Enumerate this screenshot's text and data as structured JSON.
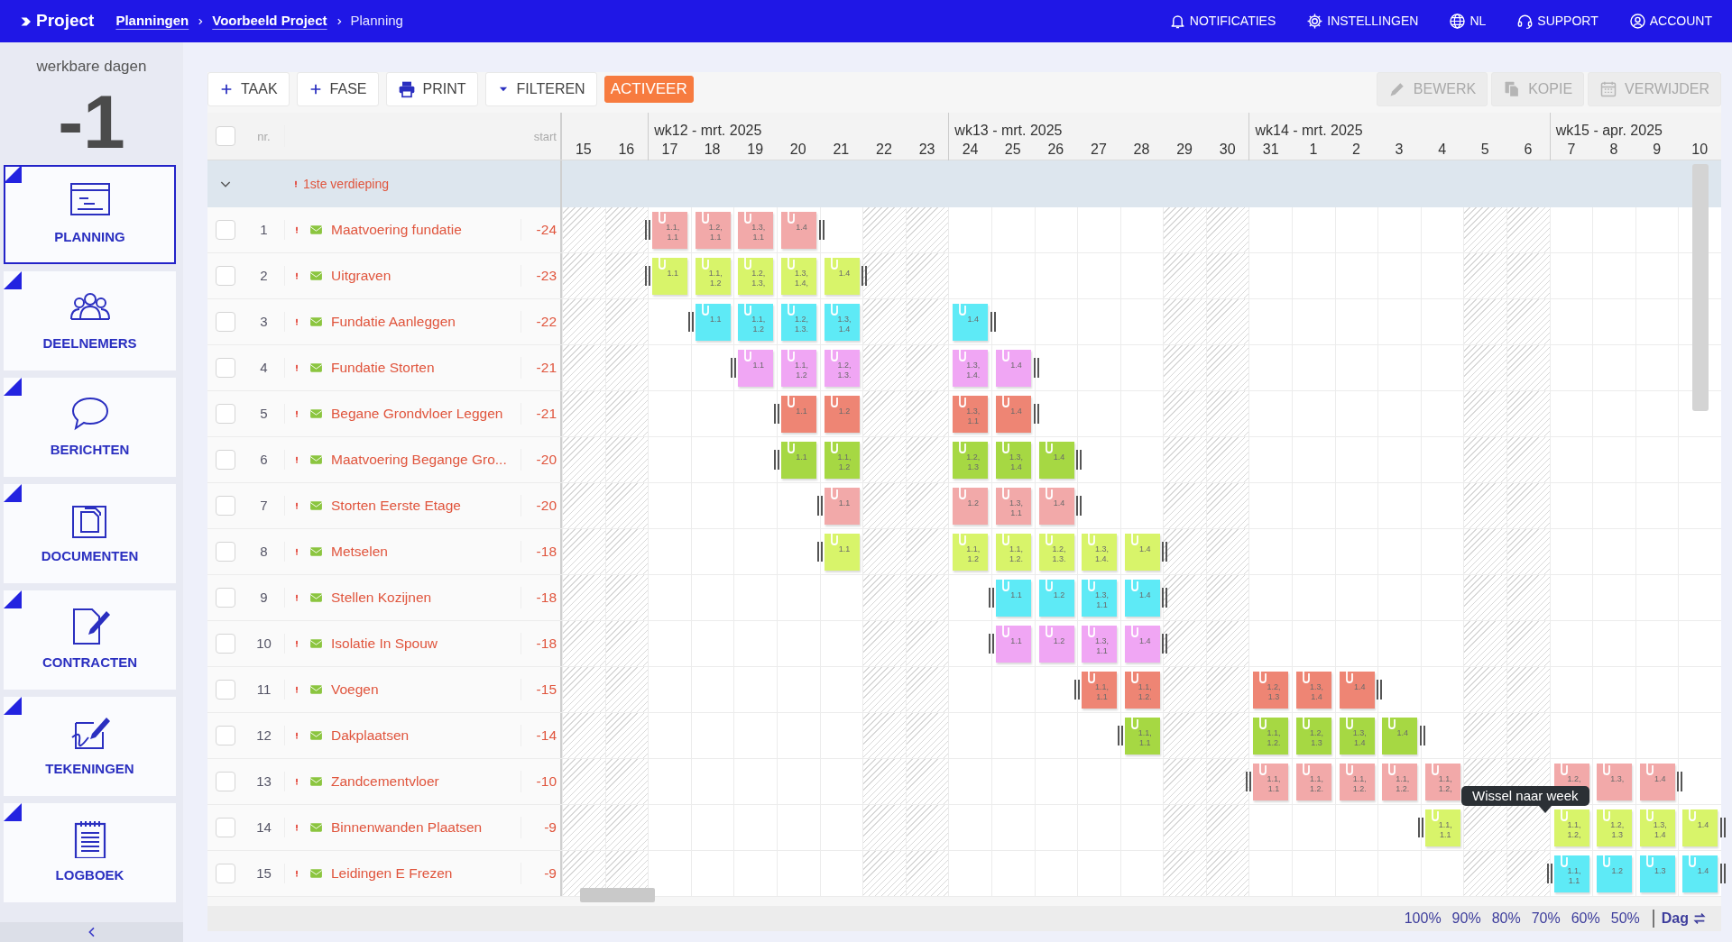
{
  "topbar": {
    "logo": "Project",
    "breadcrumbs": [
      {
        "label": "Planningen",
        "link": true
      },
      {
        "label": "Voorbeeld Project",
        "link": true
      },
      {
        "label": "Planning",
        "link": false
      }
    ],
    "menu": [
      {
        "label": "NOTIFICATIES"
      },
      {
        "label": "INSTELLINGEN"
      },
      {
        "label": "NL"
      },
      {
        "label": "SUPPORT"
      },
      {
        "label": "ACCOUNT"
      }
    ]
  },
  "sidebar": {
    "counter_label": "werkbare dagen",
    "counter": "-1",
    "items": [
      {
        "label": "PLANNING",
        "selected": true
      },
      {
        "label": "DEELNEMERS",
        "selected": false
      },
      {
        "label": "BERICHTEN",
        "selected": false
      },
      {
        "label": "DOCUMENTEN",
        "selected": false
      },
      {
        "label": "CONTRACTEN",
        "selected": false
      },
      {
        "label": "TEKENINGEN",
        "selected": false
      },
      {
        "label": "LOGBOEK",
        "selected": false
      }
    ]
  },
  "toolbar": {
    "left": [
      {
        "label": "TAAK",
        "kind": "add"
      },
      {
        "label": "FASE",
        "kind": "add"
      },
      {
        "label": "PRINT",
        "kind": "print"
      },
      {
        "label": "FILTEREN",
        "kind": "filter"
      },
      {
        "label": "ACTIVEER",
        "kind": "accent"
      }
    ],
    "right": [
      {
        "label": "BEWERK",
        "disabled": true
      },
      {
        "label": "KOPIE",
        "disabled": true
      },
      {
        "label": "VERWIJDER",
        "disabled": true
      }
    ]
  },
  "gantt": {
    "header": {
      "checked": false,
      "nr": "nr.",
      "start": "start"
    },
    "days": [
      {
        "label": "15",
        "weekend": true
      },
      {
        "label": "16",
        "weekend": true
      },
      {
        "label": "17",
        "weekend": false,
        "week": "wk12 - mrt. 2025"
      },
      {
        "label": "18",
        "weekend": false
      },
      {
        "label": "19",
        "weekend": false
      },
      {
        "label": "20",
        "weekend": false
      },
      {
        "label": "21",
        "weekend": false
      },
      {
        "label": "22",
        "weekend": true
      },
      {
        "label": "23",
        "weekend": true
      },
      {
        "label": "24",
        "weekend": false,
        "week": "wk13 - mrt. 2025"
      },
      {
        "label": "25",
        "weekend": false
      },
      {
        "label": "26",
        "weekend": false
      },
      {
        "label": "27",
        "weekend": false
      },
      {
        "label": "28",
        "weekend": false
      },
      {
        "label": "29",
        "weekend": true
      },
      {
        "label": "30",
        "weekend": true
      },
      {
        "label": "31",
        "weekend": false,
        "week": "wk14 - mrt. 2025"
      },
      {
        "label": "1",
        "weekend": false
      },
      {
        "label": "2",
        "weekend": false
      },
      {
        "label": "3",
        "weekend": false
      },
      {
        "label": "4",
        "weekend": false
      },
      {
        "label": "5",
        "weekend": true
      },
      {
        "label": "6",
        "weekend": true
      },
      {
        "label": "7",
        "weekend": false,
        "week": "wk15 - apr. 2025"
      },
      {
        "label": "8",
        "weekend": false
      },
      {
        "label": "9",
        "weekend": false
      },
      {
        "label": "10",
        "weekend": false
      }
    ],
    "group": {
      "label": "1ste verdieping",
      "expanded": true,
      "priority": true
    },
    "rows": [
      {
        "nr": "1",
        "name": "Maatvoering fundatie",
        "start": "-24",
        "checked": false,
        "priority": true,
        "mail": true,
        "color": "#f2a9a9",
        "cells": [
          {
            "kind": "empty"
          },
          {
            "kind": "empty"
          },
          {
            "kind": "note",
            "label": "1.1, 1.1"
          },
          {
            "kind": "note",
            "label": "1.2, 1.1"
          },
          {
            "kind": "note",
            "label": "1.3, 1.1"
          },
          {
            "kind": "note",
            "label": "1.4"
          },
          {
            "kind": "empty"
          },
          {
            "kind": "empty"
          },
          {
            "kind": "empty"
          },
          {
            "kind": "empty"
          },
          {
            "kind": "empty"
          },
          {
            "kind": "empty"
          },
          {
            "kind": "empty"
          },
          {
            "kind": "empty"
          },
          {
            "kind": "empty"
          },
          {
            "kind": "empty"
          },
          {
            "kind": "empty"
          },
          {
            "kind": "empty"
          },
          {
            "kind": "empty"
          },
          {
            "kind": "empty"
          },
          {
            "kind": "empty"
          },
          {
            "kind": "empty"
          },
          {
            "kind": "empty"
          },
          {
            "kind": "empty"
          },
          {
            "kind": "empty"
          },
          {
            "kind": "empty"
          },
          {
            "kind": "empty"
          }
        ]
      },
      {
        "nr": "2",
        "name": "Uitgraven",
        "start": "-23",
        "checked": false,
        "priority": true,
        "mail": true,
        "color": "#d8f46a",
        "cells": [
          {
            "kind": "empty"
          },
          {
            "kind": "empty"
          },
          {
            "kind": "note",
            "label": "1.1"
          },
          {
            "kind": "note",
            "label": "1.1, 1.2"
          },
          {
            "kind": "note",
            "label": "1.2, 1.3,"
          },
          {
            "kind": "note",
            "label": "1.3, 1.4,"
          },
          {
            "kind": "note",
            "label": "1.4"
          },
          {
            "kind": "empty"
          },
          {
            "kind": "empty"
          },
          {
            "kind": "empty"
          },
          {
            "kind": "empty"
          },
          {
            "kind": "empty"
          },
          {
            "kind": "empty"
          },
          {
            "kind": "empty"
          },
          {
            "kind": "empty"
          },
          {
            "kind": "empty"
          },
          {
            "kind": "empty"
          },
          {
            "kind": "empty"
          },
          {
            "kind": "empty"
          },
          {
            "kind": "empty"
          },
          {
            "kind": "empty"
          },
          {
            "kind": "empty"
          },
          {
            "kind": "empty"
          },
          {
            "kind": "empty"
          },
          {
            "kind": "empty"
          },
          {
            "kind": "empty"
          },
          {
            "kind": "empty"
          }
        ]
      },
      {
        "nr": "3",
        "name": "Fundatie Aanleggen",
        "start": "-22",
        "checked": false,
        "priority": true,
        "mail": true,
        "color": "#5eeaf6",
        "cells": [
          {
            "kind": "empty"
          },
          {
            "kind": "empty"
          },
          {
            "kind": "empty"
          },
          {
            "kind": "note",
            "label": "1.1"
          },
          {
            "kind": "note",
            "label": "1.1, 1.2"
          },
          {
            "kind": "note",
            "label": "1.2, 1.3."
          },
          {
            "kind": "note",
            "label": "1.3, 1.4"
          },
          {
            "kind": "empty"
          },
          {
            "kind": "empty"
          },
          {
            "kind": "note",
            "label": "1.4"
          },
          {
            "kind": "empty"
          },
          {
            "kind": "empty"
          },
          {
            "kind": "empty"
          },
          {
            "kind": "empty"
          },
          {
            "kind": "empty"
          },
          {
            "kind": "empty"
          },
          {
            "kind": "empty"
          },
          {
            "kind": "empty"
          },
          {
            "kind": "empty"
          },
          {
            "kind": "empty"
          },
          {
            "kind": "empty"
          },
          {
            "kind": "empty"
          },
          {
            "kind": "empty"
          },
          {
            "kind": "empty"
          },
          {
            "kind": "empty"
          },
          {
            "kind": "empty"
          },
          {
            "kind": "empty"
          }
        ]
      },
      {
        "nr": "4",
        "name": "Fundatie Storten",
        "start": "-21",
        "checked": false,
        "priority": true,
        "mail": true,
        "color": "#f0a6f4",
        "cells": [
          {
            "kind": "empty"
          },
          {
            "kind": "empty"
          },
          {
            "kind": "empty"
          },
          {
            "kind": "empty"
          },
          {
            "kind": "note",
            "label": "1.1"
          },
          {
            "kind": "note",
            "label": "1.1, 1.2"
          },
          {
            "kind": "note",
            "label": "1.2, 1.3."
          },
          {
            "kind": "empty"
          },
          {
            "kind": "empty"
          },
          {
            "kind": "note",
            "label": "1.3, 1.4."
          },
          {
            "kind": "note",
            "label": "1.4"
          },
          {
            "kind": "empty"
          },
          {
            "kind": "empty"
          },
          {
            "kind": "empty"
          },
          {
            "kind": "empty"
          },
          {
            "kind": "empty"
          },
          {
            "kind": "empty"
          },
          {
            "kind": "empty"
          },
          {
            "kind": "empty"
          },
          {
            "kind": "empty"
          },
          {
            "kind": "empty"
          },
          {
            "kind": "empty"
          },
          {
            "kind": "empty"
          },
          {
            "kind": "empty"
          },
          {
            "kind": "empty"
          },
          {
            "kind": "empty"
          },
          {
            "kind": "empty"
          }
        ]
      },
      {
        "nr": "5",
        "name": "Begane Grondvloer Leggen",
        "start": "-21",
        "checked": false,
        "priority": true,
        "mail": true,
        "color": "#ee8574",
        "cells": [
          {
            "kind": "empty"
          },
          {
            "kind": "empty"
          },
          {
            "kind": "empty"
          },
          {
            "kind": "empty"
          },
          {
            "kind": "empty"
          },
          {
            "kind": "note",
            "label": "1.1"
          },
          {
            "kind": "note",
            "label": "1.2"
          },
          {
            "kind": "empty"
          },
          {
            "kind": "empty"
          },
          {
            "kind": "note",
            "label": "1.3, 1.1"
          },
          {
            "kind": "note",
            "label": "1.4"
          },
          {
            "kind": "empty"
          },
          {
            "kind": "empty"
          },
          {
            "kind": "empty"
          },
          {
            "kind": "empty"
          },
          {
            "kind": "empty"
          },
          {
            "kind": "empty"
          },
          {
            "kind": "empty"
          },
          {
            "kind": "empty"
          },
          {
            "kind": "empty"
          },
          {
            "kind": "empty"
          },
          {
            "kind": "empty"
          },
          {
            "kind": "empty"
          },
          {
            "kind": "empty"
          },
          {
            "kind": "empty"
          },
          {
            "kind": "empty"
          },
          {
            "kind": "empty"
          }
        ]
      },
      {
        "nr": "6",
        "name": "Maatvoering Begange Gro...",
        "start": "-20",
        "checked": false,
        "priority": true,
        "mail": true,
        "color": "#a6d843",
        "cells": [
          {
            "kind": "empty"
          },
          {
            "kind": "empty"
          },
          {
            "kind": "empty"
          },
          {
            "kind": "empty"
          },
          {
            "kind": "empty"
          },
          {
            "kind": "note",
            "label": "1.1"
          },
          {
            "kind": "note",
            "label": "1.1, 1.2"
          },
          {
            "kind": "empty"
          },
          {
            "kind": "empty"
          },
          {
            "kind": "note",
            "label": "1.2, 1.3"
          },
          {
            "kind": "note",
            "label": "1.3, 1.4"
          },
          {
            "kind": "note",
            "label": "1.4"
          },
          {
            "kind": "empty"
          },
          {
            "kind": "empty"
          },
          {
            "kind": "empty"
          },
          {
            "kind": "empty"
          },
          {
            "kind": "empty"
          },
          {
            "kind": "empty"
          },
          {
            "kind": "empty"
          },
          {
            "kind": "empty"
          },
          {
            "kind": "empty"
          },
          {
            "kind": "empty"
          },
          {
            "kind": "empty"
          },
          {
            "kind": "empty"
          },
          {
            "kind": "empty"
          },
          {
            "kind": "empty"
          },
          {
            "kind": "empty"
          }
        ]
      },
      {
        "nr": "7",
        "name": "Storten Eerste Etage",
        "start": "-20",
        "checked": false,
        "priority": true,
        "mail": true,
        "color": "#f2a9a9",
        "cells": [
          {
            "kind": "empty"
          },
          {
            "kind": "empty"
          },
          {
            "kind": "empty"
          },
          {
            "kind": "empty"
          },
          {
            "kind": "empty"
          },
          {
            "kind": "empty"
          },
          {
            "kind": "note",
            "label": "1.1"
          },
          {
            "kind": "empty"
          },
          {
            "kind": "empty"
          },
          {
            "kind": "note",
            "label": "1.2"
          },
          {
            "kind": "note",
            "label": "1.3, 1.1"
          },
          {
            "kind": "note",
            "label": "1.4"
          },
          {
            "kind": "empty"
          },
          {
            "kind": "empty"
          },
          {
            "kind": "empty"
          },
          {
            "kind": "empty"
          },
          {
            "kind": "empty"
          },
          {
            "kind": "empty"
          },
          {
            "kind": "empty"
          },
          {
            "kind": "empty"
          },
          {
            "kind": "empty"
          },
          {
            "kind": "empty"
          },
          {
            "kind": "empty"
          },
          {
            "kind": "empty"
          },
          {
            "kind": "empty"
          },
          {
            "kind": "empty"
          },
          {
            "kind": "empty"
          }
        ]
      },
      {
        "nr": "8",
        "name": "Metselen",
        "start": "-18",
        "checked": false,
        "priority": true,
        "mail": true,
        "color": "#d8f46a",
        "cells": [
          {
            "kind": "empty"
          },
          {
            "kind": "empty"
          },
          {
            "kind": "empty"
          },
          {
            "kind": "empty"
          },
          {
            "kind": "empty"
          },
          {
            "kind": "empty"
          },
          {
            "kind": "note",
            "label": "1.1"
          },
          {
            "kind": "empty"
          },
          {
            "kind": "empty"
          },
          {
            "kind": "note",
            "label": "1.1, 1.2"
          },
          {
            "kind": "note",
            "label": "1.1, 1.2."
          },
          {
            "kind": "note",
            "label": "1.2, 1.3."
          },
          {
            "kind": "note",
            "label": "1.3, 1.4."
          },
          {
            "kind": "note",
            "label": "1.4"
          },
          {
            "kind": "empty"
          },
          {
            "kind": "empty"
          },
          {
            "kind": "empty"
          },
          {
            "kind": "empty"
          },
          {
            "kind": "empty"
          },
          {
            "kind": "empty"
          },
          {
            "kind": "empty"
          },
          {
            "kind": "empty"
          },
          {
            "kind": "empty"
          },
          {
            "kind": "empty"
          },
          {
            "kind": "empty"
          },
          {
            "kind": "empty"
          },
          {
            "kind": "empty"
          }
        ]
      },
      {
        "nr": "9",
        "name": "Stellen Kozijnen",
        "start": "-18",
        "checked": false,
        "priority": true,
        "mail": true,
        "color": "#5eeaf6",
        "cells": [
          {
            "kind": "empty"
          },
          {
            "kind": "empty"
          },
          {
            "kind": "empty"
          },
          {
            "kind": "empty"
          },
          {
            "kind": "empty"
          },
          {
            "kind": "empty"
          },
          {
            "kind": "empty"
          },
          {
            "kind": "empty"
          },
          {
            "kind": "empty"
          },
          {
            "kind": "empty"
          },
          {
            "kind": "note",
            "label": "1.1"
          },
          {
            "kind": "note",
            "label": "1.2"
          },
          {
            "kind": "note",
            "label": "1.3, 1.1"
          },
          {
            "kind": "note",
            "label": "1.4"
          },
          {
            "kind": "empty"
          },
          {
            "kind": "empty"
          },
          {
            "kind": "empty"
          },
          {
            "kind": "empty"
          },
          {
            "kind": "empty"
          },
          {
            "kind": "empty"
          },
          {
            "kind": "empty"
          },
          {
            "kind": "empty"
          },
          {
            "kind": "empty"
          },
          {
            "kind": "empty"
          },
          {
            "kind": "empty"
          },
          {
            "kind": "empty"
          },
          {
            "kind": "empty"
          }
        ]
      },
      {
        "nr": "10",
        "name": "Isolatie In Spouw",
        "start": "-18",
        "checked": false,
        "priority": true,
        "mail": true,
        "color": "#f0a6f4",
        "cells": [
          {
            "kind": "empty"
          },
          {
            "kind": "empty"
          },
          {
            "kind": "empty"
          },
          {
            "kind": "empty"
          },
          {
            "kind": "empty"
          },
          {
            "kind": "empty"
          },
          {
            "kind": "empty"
          },
          {
            "kind": "empty"
          },
          {
            "kind": "empty"
          },
          {
            "kind": "empty"
          },
          {
            "kind": "note",
            "label": "1.1"
          },
          {
            "kind": "note",
            "label": "1.2"
          },
          {
            "kind": "note",
            "label": "1.3, 1.1"
          },
          {
            "kind": "note",
            "label": "1.4"
          },
          {
            "kind": "empty"
          },
          {
            "kind": "empty"
          },
          {
            "kind": "empty"
          },
          {
            "kind": "empty"
          },
          {
            "kind": "empty"
          },
          {
            "kind": "empty"
          },
          {
            "kind": "empty"
          },
          {
            "kind": "empty"
          },
          {
            "kind": "empty"
          },
          {
            "kind": "empty"
          },
          {
            "kind": "empty"
          },
          {
            "kind": "empty"
          },
          {
            "kind": "empty"
          }
        ]
      },
      {
        "nr": "11",
        "name": "Voegen",
        "start": "-15",
        "checked": false,
        "priority": true,
        "mail": true,
        "color": "#ee8574",
        "cells": [
          {
            "kind": "empty"
          },
          {
            "kind": "empty"
          },
          {
            "kind": "empty"
          },
          {
            "kind": "empty"
          },
          {
            "kind": "empty"
          },
          {
            "kind": "empty"
          },
          {
            "kind": "empty"
          },
          {
            "kind": "empty"
          },
          {
            "kind": "empty"
          },
          {
            "kind": "empty"
          },
          {
            "kind": "empty"
          },
          {
            "kind": "empty"
          },
          {
            "kind": "note",
            "label": "1.1, 1.1"
          },
          {
            "kind": "note",
            "label": "1.1, 1.2."
          },
          {
            "kind": "empty"
          },
          {
            "kind": "empty"
          },
          {
            "kind": "note",
            "label": "1.2, 1.3"
          },
          {
            "kind": "note",
            "label": "1.3, 1.4"
          },
          {
            "kind": "note",
            "label": "1.4"
          },
          {
            "kind": "empty"
          },
          {
            "kind": "empty"
          },
          {
            "kind": "empty"
          },
          {
            "kind": "empty"
          },
          {
            "kind": "empty"
          },
          {
            "kind": "empty"
          },
          {
            "kind": "empty"
          },
          {
            "kind": "empty"
          }
        ]
      },
      {
        "nr": "12",
        "name": "Dakplaatsen",
        "start": "-14",
        "checked": false,
        "priority": true,
        "mail": true,
        "color": "#a6d843",
        "cells": [
          {
            "kind": "empty"
          },
          {
            "kind": "empty"
          },
          {
            "kind": "empty"
          },
          {
            "kind": "empty"
          },
          {
            "kind": "empty"
          },
          {
            "kind": "empty"
          },
          {
            "kind": "empty"
          },
          {
            "kind": "empty"
          },
          {
            "kind": "empty"
          },
          {
            "kind": "empty"
          },
          {
            "kind": "empty"
          },
          {
            "kind": "empty"
          },
          {
            "kind": "empty"
          },
          {
            "kind": "note",
            "label": "1.1, 1.1"
          },
          {
            "kind": "empty"
          },
          {
            "kind": "empty"
          },
          {
            "kind": "note",
            "label": "1.1, 1.2."
          },
          {
            "kind": "note",
            "label": "1.2, 1.3"
          },
          {
            "kind": "note",
            "label": "1.3, 1.4"
          },
          {
            "kind": "note",
            "label": "1.4"
          },
          {
            "kind": "empty"
          },
          {
            "kind": "empty"
          },
          {
            "kind": "empty"
          },
          {
            "kind": "empty"
          },
          {
            "kind": "empty"
          },
          {
            "kind": "empty"
          },
          {
            "kind": "empty"
          }
        ]
      },
      {
        "nr": "13",
        "name": "Zandcementvloer",
        "start": "-10",
        "checked": false,
        "priority": true,
        "mail": true,
        "color": "#f2a9a9",
        "cells": [
          {
            "kind": "empty"
          },
          {
            "kind": "empty"
          },
          {
            "kind": "empty"
          },
          {
            "kind": "empty"
          },
          {
            "kind": "empty"
          },
          {
            "kind": "empty"
          },
          {
            "kind": "empty"
          },
          {
            "kind": "empty"
          },
          {
            "kind": "empty"
          },
          {
            "kind": "empty"
          },
          {
            "kind": "empty"
          },
          {
            "kind": "empty"
          },
          {
            "kind": "empty"
          },
          {
            "kind": "empty"
          },
          {
            "kind": "empty"
          },
          {
            "kind": "empty"
          },
          {
            "kind": "note",
            "label": "1.1, 1.1"
          },
          {
            "kind": "note",
            "label": "1.1, 1.2."
          },
          {
            "kind": "note",
            "label": "1.1, 1.2."
          },
          {
            "kind": "note",
            "label": "1.1, 1.2."
          },
          {
            "kind": "note",
            "label": "1.1, 1.2,"
          },
          {
            "kind": "empty"
          },
          {
            "kind": "empty"
          },
          {
            "kind": "note",
            "label": "1.2,"
          },
          {
            "kind": "note",
            "label": "1.3,"
          },
          {
            "kind": "note",
            "label": "1.4"
          },
          {
            "kind": "empty"
          }
        ]
      },
      {
        "nr": "14",
        "name": "Binnenwanden Plaatsen",
        "start": "-9",
        "checked": false,
        "priority": true,
        "mail": true,
        "color": "#d8f46a",
        "cells": [
          {
            "kind": "empty"
          },
          {
            "kind": "empty"
          },
          {
            "kind": "empty"
          },
          {
            "kind": "empty"
          },
          {
            "kind": "empty"
          },
          {
            "kind": "empty"
          },
          {
            "kind": "empty"
          },
          {
            "kind": "empty"
          },
          {
            "kind": "empty"
          },
          {
            "kind": "empty"
          },
          {
            "kind": "empty"
          },
          {
            "kind": "empty"
          },
          {
            "kind": "empty"
          },
          {
            "kind": "empty"
          },
          {
            "kind": "empty"
          },
          {
            "kind": "empty"
          },
          {
            "kind": "empty"
          },
          {
            "kind": "empty"
          },
          {
            "kind": "empty"
          },
          {
            "kind": "empty"
          },
          {
            "kind": "note",
            "label": "1.1, 1.1"
          },
          {
            "kind": "empty"
          },
          {
            "kind": "empty"
          },
          {
            "kind": "note",
            "label": "1.1, 1.2,"
          },
          {
            "kind": "note",
            "label": "1.2, 1.3"
          },
          {
            "kind": "note",
            "label": "1.3, 1.4"
          },
          {
            "kind": "note",
            "label": "1.4"
          }
        ]
      },
      {
        "nr": "15",
        "name": "Leidingen E Frezen",
        "start": "-9",
        "checked": false,
        "priority": true,
        "mail": true,
        "color": "#5eeaf6",
        "cells": [
          {
            "kind": "empty"
          },
          {
            "kind": "empty"
          },
          {
            "kind": "empty"
          },
          {
            "kind": "empty"
          },
          {
            "kind": "empty"
          },
          {
            "kind": "empty"
          },
          {
            "kind": "empty"
          },
          {
            "kind": "empty"
          },
          {
            "kind": "empty"
          },
          {
            "kind": "empty"
          },
          {
            "kind": "empty"
          },
          {
            "kind": "empty"
          },
          {
            "kind": "empty"
          },
          {
            "kind": "empty"
          },
          {
            "kind": "empty"
          },
          {
            "kind": "empty"
          },
          {
            "kind": "empty"
          },
          {
            "kind": "empty"
          },
          {
            "kind": "empty"
          },
          {
            "kind": "empty"
          },
          {
            "kind": "empty"
          },
          {
            "kind": "empty"
          },
          {
            "kind": "empty"
          },
          {
            "kind": "note",
            "label": "1.1, 1.1"
          },
          {
            "kind": "note",
            "label": "1.2"
          },
          {
            "kind": "note",
            "label": "1.3"
          },
          {
            "kind": "note",
            "label": "1.4"
          }
        ]
      }
    ],
    "tooltip": "Wissel naar week",
    "zoom_levels": [
      {
        "label": "100%"
      },
      {
        "label": "90%"
      },
      {
        "label": "80%"
      },
      {
        "label": "70%"
      },
      {
        "label": "60%"
      },
      {
        "label": "50%"
      }
    ],
    "view": "Dag"
  }
}
